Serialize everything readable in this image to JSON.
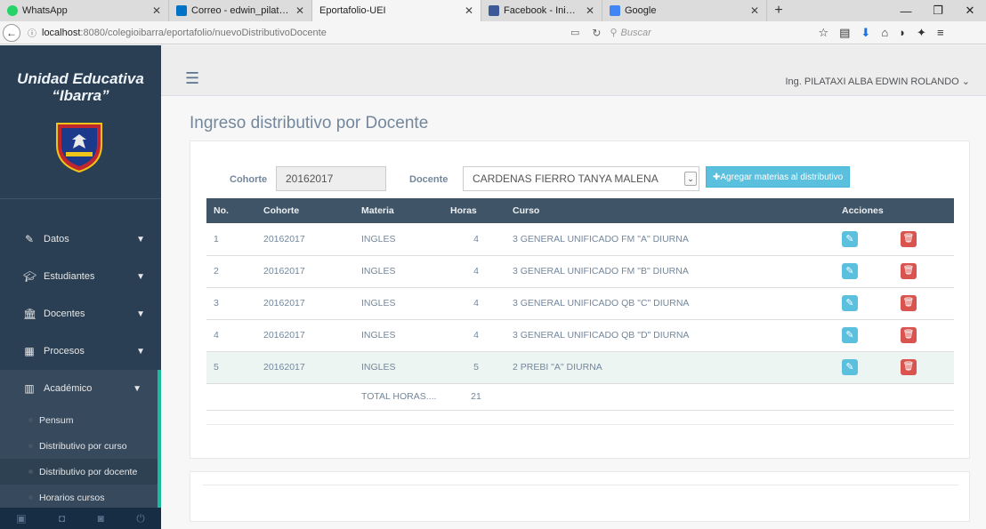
{
  "browser": {
    "tabs": [
      {
        "label": "WhatsApp",
        "color": "#25d366"
      },
      {
        "label": "Correo - edwin_pilataxi@hot",
        "color": "#0072c6"
      },
      {
        "label": "Eportafolio-UEI",
        "color": "#f5f5f5"
      },
      {
        "label": "Facebook - Inicia sesión o re",
        "color": "#3b5998"
      },
      {
        "label": "Google",
        "color": "#4285f4"
      }
    ],
    "new_tab": "+",
    "url_host": "localhost",
    "url_path": ":8080/colegioibarra/eportafolio/nuevoDistributivoDocente",
    "search_placeholder": "Buscar"
  },
  "sidebar": {
    "brand_line1": "Unidad Educativa",
    "brand_line2": "“Ibarra”",
    "items": [
      {
        "label": "Datos",
        "icon": "edit-icon"
      },
      {
        "label": "Estudiantes",
        "icon": "graduation-cap-icon"
      },
      {
        "label": "Docentes",
        "icon": "institution-icon"
      },
      {
        "label": "Procesos",
        "icon": "table-icon"
      },
      {
        "label": "Académico",
        "icon": "book-icon"
      }
    ],
    "submenu": [
      {
        "label": "Pensum"
      },
      {
        "label": "Distributivo por curso"
      },
      {
        "label": "Distributivo por docente"
      },
      {
        "label": "Horarios cursos"
      }
    ]
  },
  "topnav": {
    "user": "Ing. PILATAXI ALBA EDWIN ROLANDO"
  },
  "page": {
    "title": "Ingreso distributivo por Docente"
  },
  "form": {
    "cohorte_label": "Cohorte",
    "cohorte_value": "20162017",
    "docente_label": "Docente",
    "docente_value": "CARDENAS FIERRO TANYA MALENA",
    "add_button": "Agregar materias al distributivo"
  },
  "table": {
    "headers": [
      "No.",
      "Cohorte",
      "Materia",
      "Horas",
      "Curso",
      "Acciones"
    ],
    "rows": [
      {
        "no": "1",
        "cohorte": "20162017",
        "materia": "INGLES",
        "horas": "4",
        "curso": "3 GENERAL UNIFICADO FM \"A\" DIURNA"
      },
      {
        "no": "2",
        "cohorte": "20162017",
        "materia": "INGLES",
        "horas": "4",
        "curso": "3 GENERAL UNIFICADO FM \"B\" DIURNA"
      },
      {
        "no": "3",
        "cohorte": "20162017",
        "materia": "INGLES",
        "horas": "4",
        "curso": "3 GENERAL UNIFICADO QB \"C\" DIURNA"
      },
      {
        "no": "4",
        "cohorte": "20162017",
        "materia": "INGLES",
        "horas": "4",
        "curso": "3 GENERAL UNIFICADO QB \"D\" DIURNA"
      },
      {
        "no": "5",
        "cohorte": "20162017",
        "materia": "INGLES",
        "horas": "5",
        "curso": "2 PREBI \"A\" DIURNA"
      }
    ],
    "total_label": "TOTAL HORAS....",
    "total_value": "21"
  },
  "colors": {
    "sidebar_bg": "#2a3f54",
    "accent": "#1abb9c",
    "header_bg": "#405467",
    "edit": "#5bc0de",
    "delete": "#d9534f"
  }
}
